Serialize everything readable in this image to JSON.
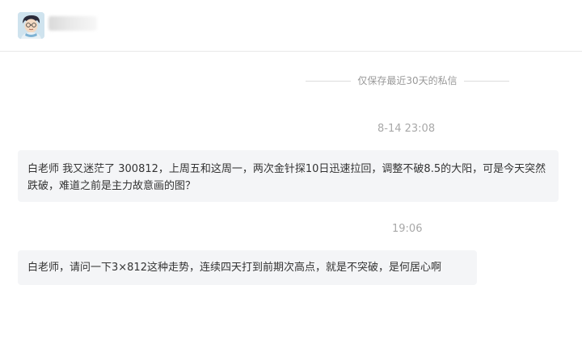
{
  "header": {
    "avatar_icon": "cartoon-avatar-icon",
    "username": ""
  },
  "conversation": {
    "notice": "仅保存最近30天的私信",
    "messages": [
      {
        "timestamp": "8-14 23:08",
        "text": "白老师 我又迷茫了 300812，上周五和这周一，两次金针探10日迅速拉回，调整不破8.5的大阳，可是今天突然跌破，难道之前是主力故意画的图？"
      },
      {
        "timestamp": "19:06",
        "text": "白老师，请问一下3×812这种走势，连续四天打到前期次高点，就是不突破，是何居心啊"
      }
    ]
  },
  "colors": {
    "bubble_background": "#f4f5f7",
    "timestamp_text": "#a8a8a8",
    "notice_text": "#999999",
    "message_text": "#333333"
  }
}
